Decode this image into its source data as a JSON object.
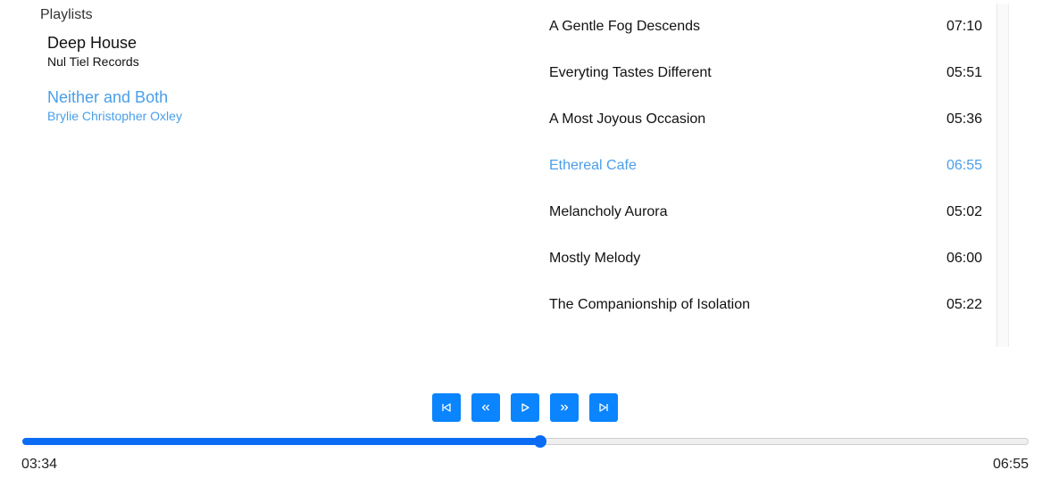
{
  "playlists": {
    "title": "Playlists",
    "items": [
      {
        "name": "Deep House",
        "artist": "Nul Tiel Records",
        "active": false
      },
      {
        "name": "Neither and Both",
        "artist": "Brylie Christopher Oxley",
        "active": true
      }
    ]
  },
  "tracks": [
    {
      "title": "A Gentle Fog Descends",
      "duration": "07:10",
      "active": false
    },
    {
      "title": "Everyting Tastes Different",
      "duration": "05:51",
      "active": false
    },
    {
      "title": "A Most Joyous Occasion",
      "duration": "05:36",
      "active": false
    },
    {
      "title": "Ethereal Cafe",
      "duration": "06:55",
      "active": true
    },
    {
      "title": "Melancholy Aurora",
      "duration": "05:02",
      "active": false
    },
    {
      "title": "Mostly Melody",
      "duration": "06:00",
      "active": false
    },
    {
      "title": "The Companionship of Isolation",
      "duration": "05:22",
      "active": false
    }
  ],
  "controls": [
    {
      "name": "skip-previous-icon"
    },
    {
      "name": "rewind-icon"
    },
    {
      "name": "play-icon"
    },
    {
      "name": "fast-forward-icon"
    },
    {
      "name": "skip-next-icon"
    }
  ],
  "player": {
    "elapsed": "03:34",
    "total": "06:55",
    "progress_fraction": 0.515
  },
  "colors": {
    "accent": "#0a84ff",
    "active_text": "#4a9ee8"
  }
}
